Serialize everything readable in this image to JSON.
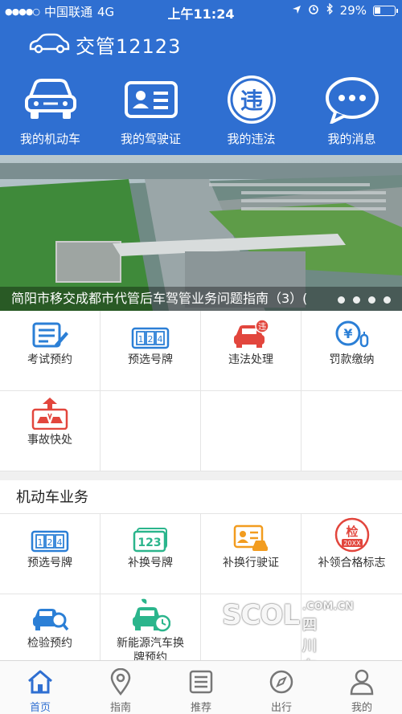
{
  "status_bar": {
    "carrier": "中国联通",
    "network": "4G",
    "time": "上午11:24",
    "battery": "29%"
  },
  "header": {
    "app_title": "交管12123",
    "quick_nav": [
      {
        "label": "我的机动车",
        "icon": "car-icon"
      },
      {
        "label": "我的驾驶证",
        "icon": "license-card-icon"
      },
      {
        "label": "我的违法",
        "icon": "violation-circle-icon"
      },
      {
        "label": "我的消息",
        "icon": "message-bubble-icon"
      }
    ]
  },
  "banner": {
    "caption": "简阳市移交成都市代管后车驾管业务问题指南（3）(",
    "dots": 4,
    "active_dot": 0
  },
  "services": [
    {
      "label": "考试预约",
      "icon": "exam-booking-icon"
    },
    {
      "label": "预选号牌",
      "icon": "plate-select-icon"
    },
    {
      "label": "违法处理",
      "icon": "violation-handle-icon"
    },
    {
      "label": "罚款缴纳",
      "icon": "fine-payment-icon"
    },
    {
      "label": "事故快处",
      "icon": "accident-handle-icon"
    }
  ],
  "vehicle_section": {
    "title": "机动车业务",
    "items": [
      {
        "label": "预选号牌",
        "icon": "plate-select-icon"
      },
      {
        "label": "补换号牌",
        "icon": "plate-replace-icon"
      },
      {
        "label": "补换行驶证",
        "icon": "driving-permit-icon"
      },
      {
        "label": "补领合格标志",
        "icon": "inspection-badge-icon",
        "badge_top": "检",
        "badge_bottom": "20XX"
      },
      {
        "label": "检验预约",
        "icon": "inspection-booking-icon"
      },
      {
        "label": "新能源汽车换牌预约",
        "icon": "new-energy-car-icon"
      }
    ]
  },
  "watermark": {
    "big": "SCOL",
    "domain": ".COM.CN",
    "cn": "四川在线"
  },
  "tabbar": {
    "tabs": [
      {
        "label": "首页",
        "icon": "home-icon",
        "active": true
      },
      {
        "label": "指南",
        "icon": "location-pin-icon",
        "active": false
      },
      {
        "label": "推荐",
        "icon": "list-icon",
        "active": false
      },
      {
        "label": "出行",
        "icon": "compass-icon",
        "active": false
      },
      {
        "label": "我的",
        "icon": "user-icon",
        "active": false
      }
    ]
  },
  "colors": {
    "primary_blue": "#2f6fd1",
    "icon_blue": "#2b7fd6",
    "icon_red": "#e2463d",
    "icon_orange": "#f29c1f",
    "icon_green": "#2bb58c"
  }
}
